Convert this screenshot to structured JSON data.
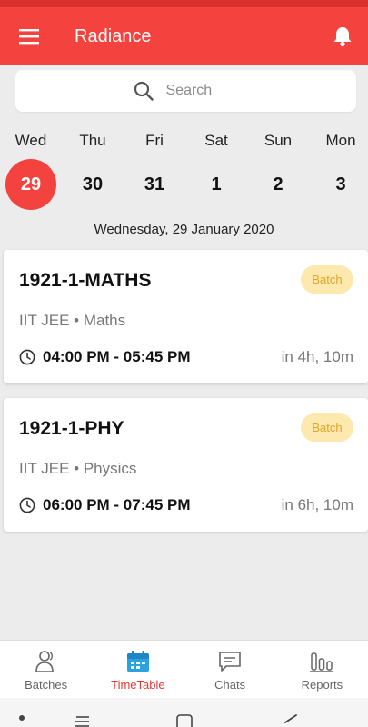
{
  "app_bar": {
    "title": "Radiance",
    "menu_icon": "menu-icon",
    "bell_icon": "bell-icon",
    "color": "#f4433e"
  },
  "search": {
    "placeholder": "Search"
  },
  "week": [
    {
      "day": "Wed",
      "date": "29",
      "active": true
    },
    {
      "day": "Thu",
      "date": "30",
      "active": false
    },
    {
      "day": "Fri",
      "date": "31",
      "active": false
    },
    {
      "day": "Sat",
      "date": "1",
      "active": false
    },
    {
      "day": "Sun",
      "date": "2",
      "active": false
    },
    {
      "day": "Mon",
      "date": "3",
      "active": false
    }
  ],
  "selected_date_label": "Wednesday, 29 January 2020",
  "classes": [
    {
      "title": "1921-1-MATHS",
      "badge": "Batch",
      "subtitle": "IIT JEE • Maths",
      "time": "04:00 PM - 05:45 PM",
      "relative": "in 4h, 10m"
    },
    {
      "title": "1921-1-PHY",
      "badge": "Batch",
      "subtitle": "IIT JEE • Physics",
      "time": "06:00 PM - 07:45 PM",
      "relative": "in 6h, 10m"
    }
  ],
  "bottom_nav": [
    {
      "label": "Batches",
      "icon": "batches-icon",
      "active": false
    },
    {
      "label": "TimeTable",
      "icon": "calendar-icon",
      "active": true
    },
    {
      "label": "Chats",
      "icon": "chat-icon",
      "active": false
    },
    {
      "label": "Reports",
      "icon": "reports-icon",
      "active": false
    }
  ],
  "colors": {
    "accent": "#f4433e",
    "badge_bg": "#fde9ad",
    "badge_text": "#e0a52a",
    "nav_active": "#e53935"
  }
}
